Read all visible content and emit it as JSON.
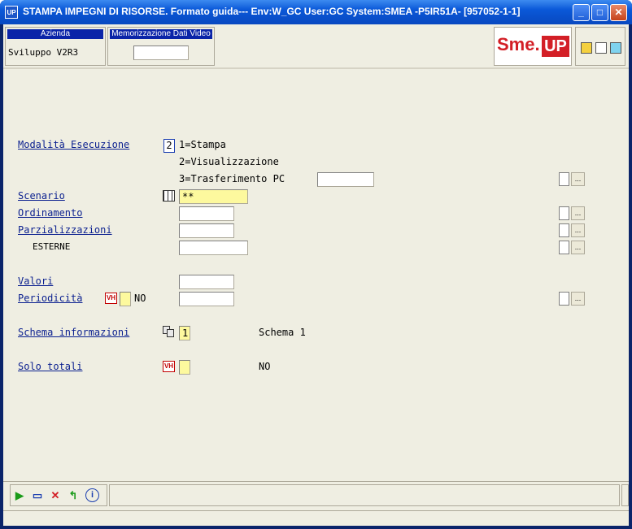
{
  "window": {
    "title": "STAMPA IMPEGNI DI RISORSE.  Formato guida--- Env:W_GC User:GC System:SMEA -P5IR51A- [957052-1-1]",
    "app_icon": "UP",
    "minimize": "_",
    "maximize": "□",
    "close": "✕"
  },
  "header": {
    "azienda_label": "Azienda",
    "azienda_value": "Sviluppo V2R3",
    "memo_label": "Memorizzazione Dati Video",
    "memo_value": "",
    "logo_left": "Sme.",
    "logo_right": "UP"
  },
  "form": {
    "modalita": {
      "label": "Modalità Esecuzione",
      "value": "2",
      "options": [
        "1=Stampa",
        "2=Visualizzazione",
        "3=Trasferimento PC"
      ],
      "trasferimento_value": ""
    },
    "scenario": {
      "label": "Scenario",
      "value": "**"
    },
    "ordinamento": {
      "label": "Ordinamento",
      "value": ""
    },
    "parzializzazioni": {
      "label": "Parzializzazioni",
      "value": ""
    },
    "esterne": {
      "label": "ESTERNE",
      "value": ""
    },
    "valori": {
      "label": "Valori",
      "value": ""
    },
    "periodicita": {
      "label": "Periodicità",
      "flag": "",
      "flag_text": "NO",
      "value": ""
    },
    "schema": {
      "label": "Schema informazioni",
      "value": "1",
      "description": "Schema 1"
    },
    "solo_totali": {
      "label": "Solo totali",
      "flag": "",
      "text": "NO"
    }
  },
  "buttons": {
    "dots": "..."
  },
  "icons": {
    "vh": "VH",
    "confirm": "▶",
    "edit": "▭",
    "cancel": "✕",
    "back": "↰",
    "info": "i"
  },
  "colors": {
    "accent": "#0a1f8f",
    "logo_red": "#d31f26",
    "field_yellow": "#fdf99e"
  }
}
